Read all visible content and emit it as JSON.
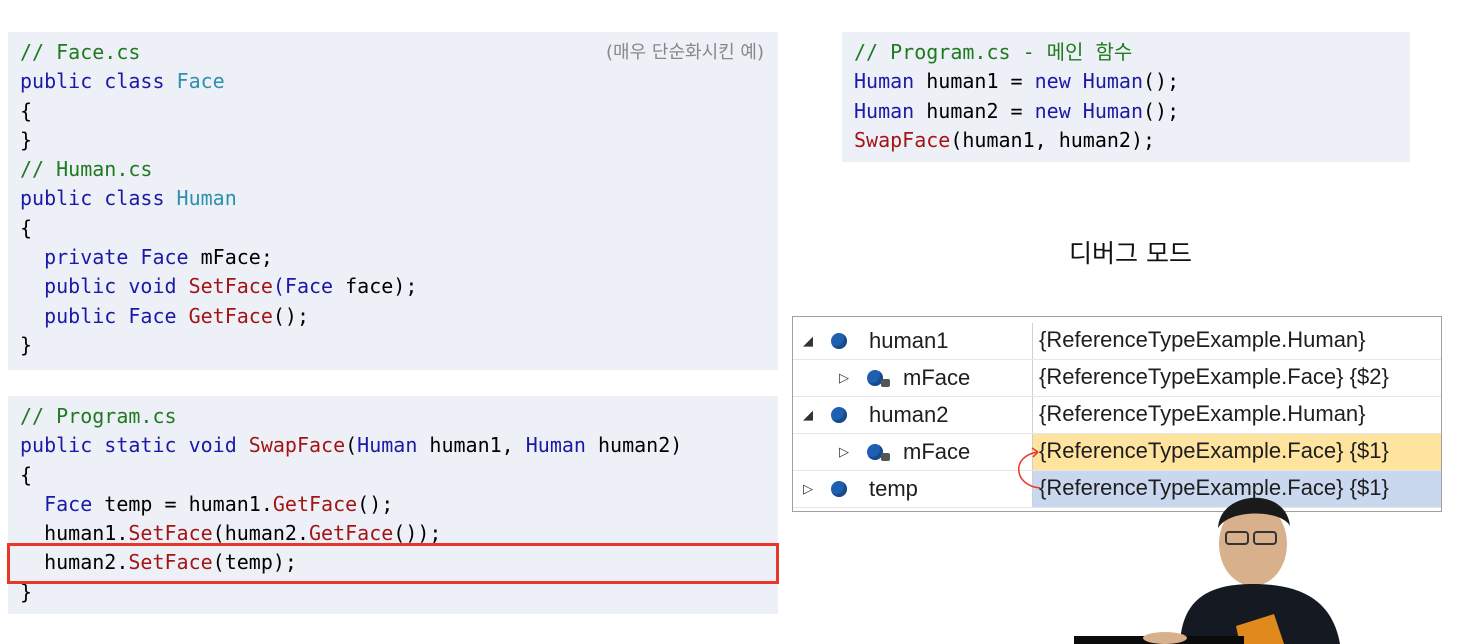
{
  "face_cs_box": {
    "note": "(매우 단순화시킨 예)",
    "lines": [
      [
        {
          "c": "cm",
          "t": "// Face.cs"
        }
      ],
      [
        {
          "c": "kw",
          "t": "public class "
        },
        {
          "c": "ty",
          "t": "Face"
        }
      ],
      [
        {
          "c": "tx",
          "t": "{"
        }
      ],
      [
        {
          "c": "tx",
          "t": "}"
        }
      ],
      [
        {
          "c": "cm",
          "t": "// Human.cs"
        }
      ],
      [
        {
          "c": "kw",
          "t": "public class "
        },
        {
          "c": "ty",
          "t": "Human"
        }
      ],
      [
        {
          "c": "tx",
          "t": "{"
        }
      ],
      [
        {
          "c": "kw",
          "t": "  private Face "
        },
        {
          "c": "tx",
          "t": "mFace;"
        }
      ],
      [
        {
          "c": "kw",
          "t": "  public void "
        },
        {
          "c": "fn",
          "t": "SetFace"
        },
        {
          "c": "kw",
          "t": "(Face "
        },
        {
          "c": "tx",
          "t": "face);"
        }
      ],
      [
        {
          "c": "kw",
          "t": "  public Face "
        },
        {
          "c": "fn",
          "t": "GetFace"
        },
        {
          "c": "tx",
          "t": "();"
        }
      ],
      [
        {
          "c": "tx",
          "t": "}"
        }
      ]
    ]
  },
  "program_cs_box": {
    "lines": [
      [
        {
          "c": "cm",
          "t": "// Program.cs"
        }
      ],
      [
        {
          "c": "kw",
          "t": "public static void "
        },
        {
          "c": "fn",
          "t": "SwapFace"
        },
        {
          "c": "tx",
          "t": "("
        },
        {
          "c": "kw",
          "t": "Human "
        },
        {
          "c": "tx",
          "t": "human1, "
        },
        {
          "c": "kw",
          "t": "Human "
        },
        {
          "c": "tx",
          "t": "human2)"
        }
      ],
      [
        {
          "c": "tx",
          "t": "{"
        }
      ],
      [
        {
          "c": "kw",
          "t": "  Face "
        },
        {
          "c": "tx",
          "t": "temp = human1."
        },
        {
          "c": "fn",
          "t": "GetFace"
        },
        {
          "c": "tx",
          "t": "();"
        }
      ],
      [
        {
          "c": "tx",
          "t": "  human1."
        },
        {
          "c": "fn",
          "t": "SetFace"
        },
        {
          "c": "tx",
          "t": "(human2."
        },
        {
          "c": "fn",
          "t": "GetFace"
        },
        {
          "c": "tx",
          "t": "());"
        }
      ],
      [
        {
          "c": "tx",
          "t": "  human2."
        },
        {
          "c": "fn",
          "t": "SetFace"
        },
        {
          "c": "tx",
          "t": "(temp);"
        }
      ],
      [
        {
          "c": "tx",
          "t": "}"
        }
      ]
    ]
  },
  "main_box": {
    "lines": [
      [
        {
          "c": "cm",
          "t": "// Program.cs - 메인 함수"
        }
      ],
      [
        {
          "c": "kw",
          "t": "Human "
        },
        {
          "c": "tx",
          "t": "human1 = "
        },
        {
          "c": "kw",
          "t": "new Human"
        },
        {
          "c": "tx",
          "t": "();"
        }
      ],
      [
        {
          "c": "kw",
          "t": "Human "
        },
        {
          "c": "tx",
          "t": "human2 = "
        },
        {
          "c": "kw",
          "t": "new Human"
        },
        {
          "c": "tx",
          "t": "();"
        }
      ],
      [
        {
          "c": "fn",
          "t": "SwapFace"
        },
        {
          "c": "tx",
          "t": "(human1, human2);"
        }
      ]
    ]
  },
  "debug_title": "디버그 모드",
  "watch": [
    {
      "name": "human1",
      "value": "{ReferenceTypeExample.Human}",
      "level": 0,
      "expander": "expanded",
      "lock": false,
      "highlight": ""
    },
    {
      "name": "mFace",
      "value": "{ReferenceTypeExample.Face} {$2}",
      "level": 1,
      "expander": "collapsed",
      "lock": true,
      "highlight": ""
    },
    {
      "name": "human2",
      "value": "{ReferenceTypeExample.Human}",
      "level": 0,
      "expander": "expanded",
      "lock": false,
      "highlight": ""
    },
    {
      "name": "mFace",
      "value": "{ReferenceTypeExample.Face} {$1}",
      "level": 1,
      "expander": "collapsed",
      "lock": true,
      "highlight": "#ffe4a0"
    },
    {
      "name": "temp",
      "value": "{ReferenceTypeExample.Face} {$1}",
      "level": 0,
      "expander": "collapsed",
      "lock": false,
      "highlight": "#c9d8ee"
    }
  ],
  "colors": {
    "comment": "#1f7a1f",
    "keyword": "#1a1aa6",
    "type": "#2b91af",
    "method": "#a31515",
    "code_bg": "#eef0f7",
    "highlight_frame": "#e8382a",
    "arrow": "#e8382a"
  },
  "icons": {
    "object": "object-icon",
    "lock": "lock-icon",
    "expand": "triangle-expanded-icon",
    "collapse": "triangle-collapsed-icon"
  }
}
